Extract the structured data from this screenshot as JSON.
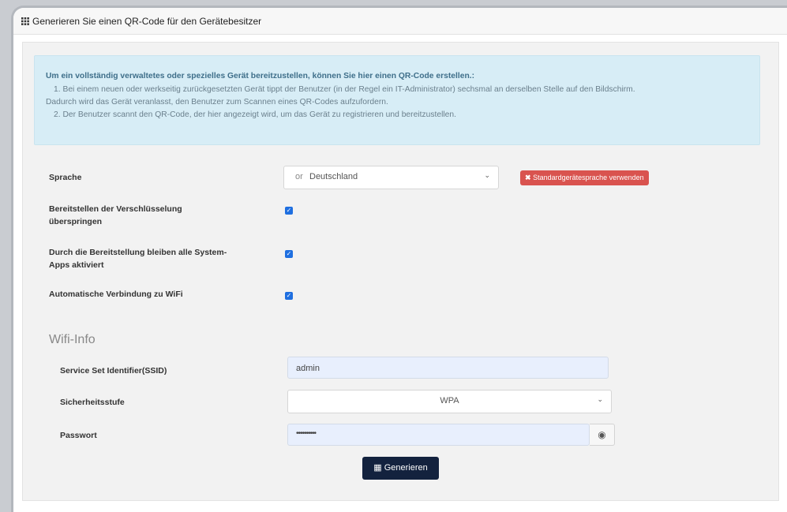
{
  "panel": {
    "title": "Generieren Sie einen QR-Code für den Gerätebesitzer",
    "icon": "grid-icon"
  },
  "info": {
    "title": "Um ein vollständig verwaltetes oder spezielles Gerät bereitzustellen, können Sie hier einen QR-Code erstellen.:",
    "line1": "1. Bei einem neuen oder werkseitig zurückgesetzten Gerät tippt der Benutzer (in der Regel ein IT-Administrator) sechsmal an derselben Stelle auf den Bildschirm.",
    "line2": "Dadurch wird das Gerät veranlasst, den Benutzer zum Scannen eines QR-Codes aufzufordern.",
    "line3": "2. Der Benutzer scannt den QR-Code, der hier angezeigt wird, um das Gerät zu registrieren und bereitzustellen."
  },
  "form": {
    "language_label": "Sprache",
    "language_value": "Deutschland",
    "language_prefix": "or",
    "default_language_button": "Standardgerätesprache verwenden",
    "skip_encryption_label_1": "Bereitstellen der Verschlüsselung",
    "skip_encryption_label_2": "überspringen",
    "skip_encryption_checked": true,
    "system_apps_label_1": "Durch die Bereitstellung bleiben alle System-",
    "system_apps_label_2": "Apps aktiviert",
    "system_apps_checked": true,
    "auto_wifi_label": "Automatische Verbindung zu WiFi",
    "auto_wifi_checked": true
  },
  "wifi": {
    "section_title": "Wifi-Info",
    "ssid_label": "Service Set Identifier(SSID)",
    "ssid_value": "admin",
    "security_label": "Sicherheitsstufe",
    "security_value": "WPA",
    "password_label": "Passwort",
    "password_value": "••••••••••",
    "eye_icon": "eye-icon"
  },
  "actions": {
    "generate_label": "Generieren",
    "generate_icon": "qr-icon"
  },
  "colors": {
    "info_bg": "#d7edf6",
    "danger": "#d9534f",
    "primary_dark": "#13223e",
    "checkbox": "#1f6fe0"
  }
}
